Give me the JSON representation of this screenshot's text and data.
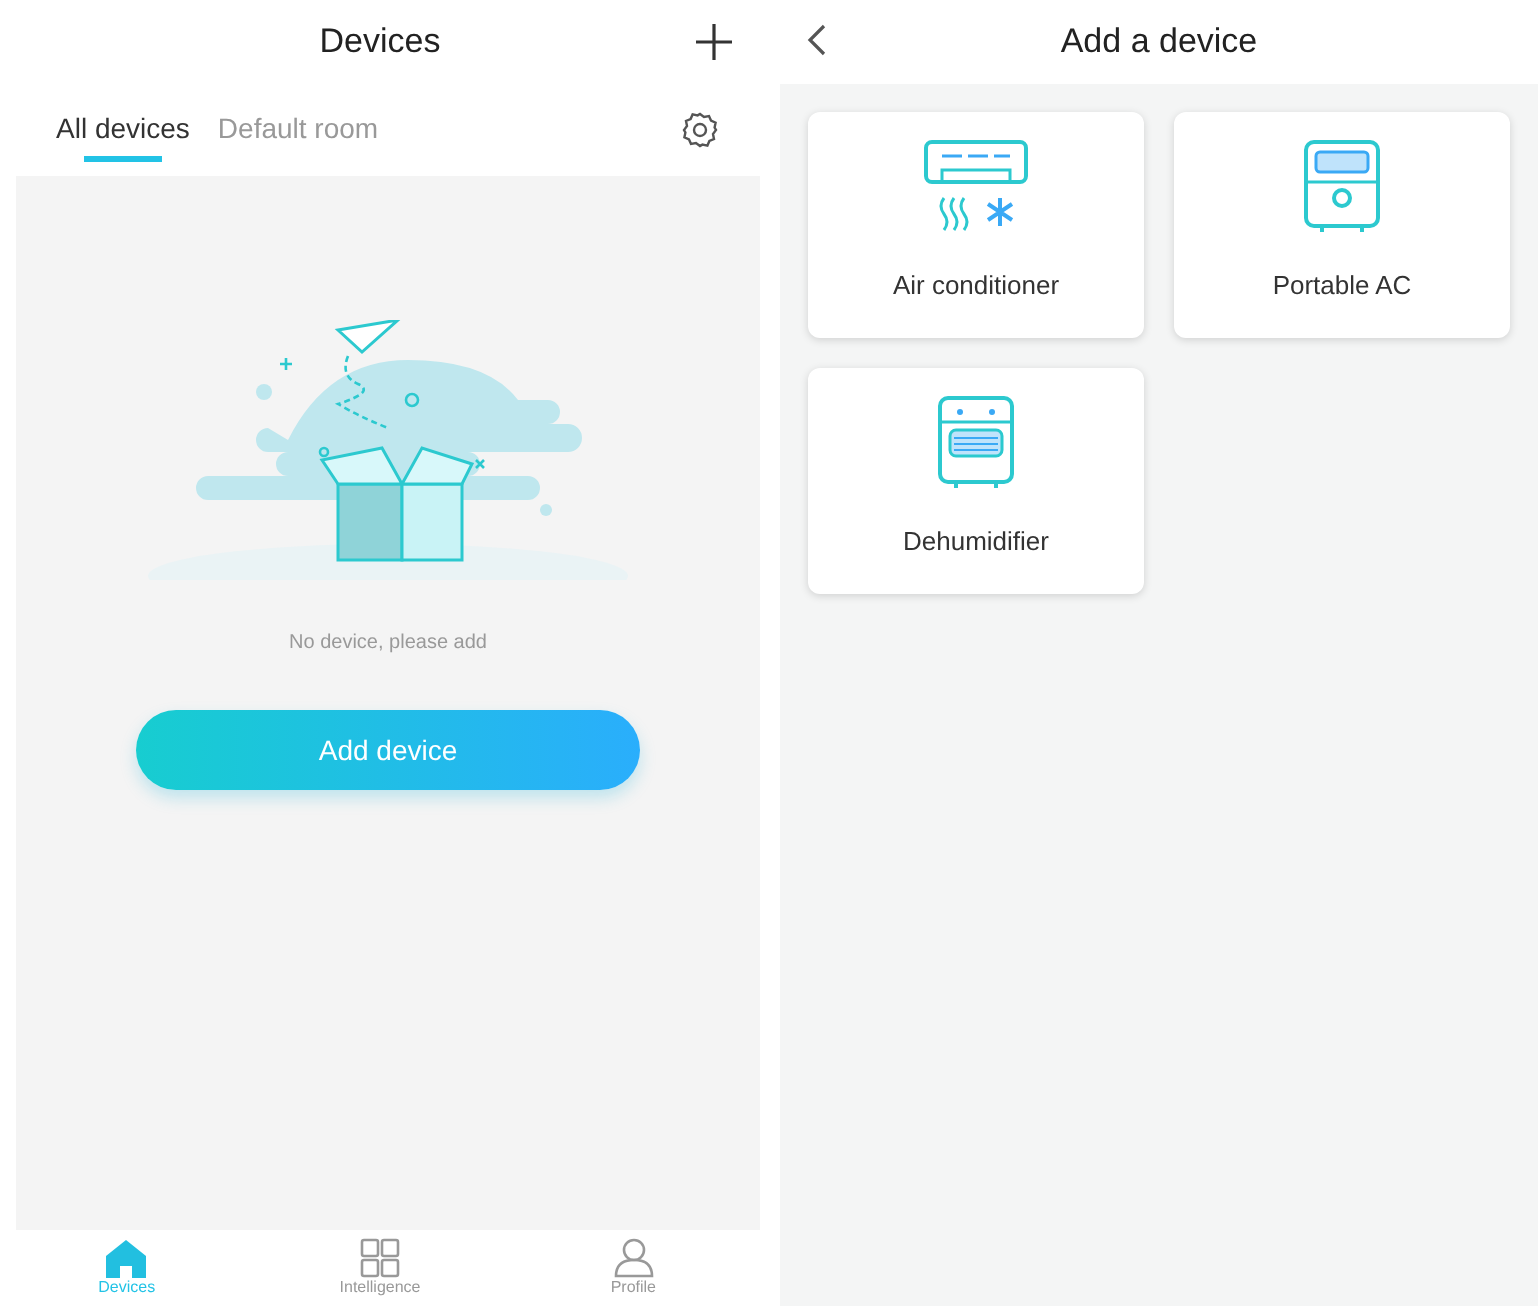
{
  "devices_screen": {
    "title": "Devices",
    "tabs": [
      {
        "label": "All devices",
        "selected": true
      },
      {
        "label": "Default room",
        "selected": false
      }
    ],
    "empty_message": "No device, please add",
    "add_button": "Add device"
  },
  "bottom_nav": [
    {
      "label": "Devices",
      "kind": "home",
      "selected": true
    },
    {
      "label": "Intelligence",
      "kind": "grid",
      "selected": false
    },
    {
      "label": "Profile",
      "kind": "person",
      "selected": false
    }
  ],
  "add_screen": {
    "title": "Add a device",
    "devices": [
      {
        "label": "Air conditioner",
        "kind": "air-conditioner"
      },
      {
        "label": "Portable AC",
        "kind": "portable-ac"
      },
      {
        "label": "Dehumidifier",
        "kind": "dehumidifier"
      }
    ]
  }
}
